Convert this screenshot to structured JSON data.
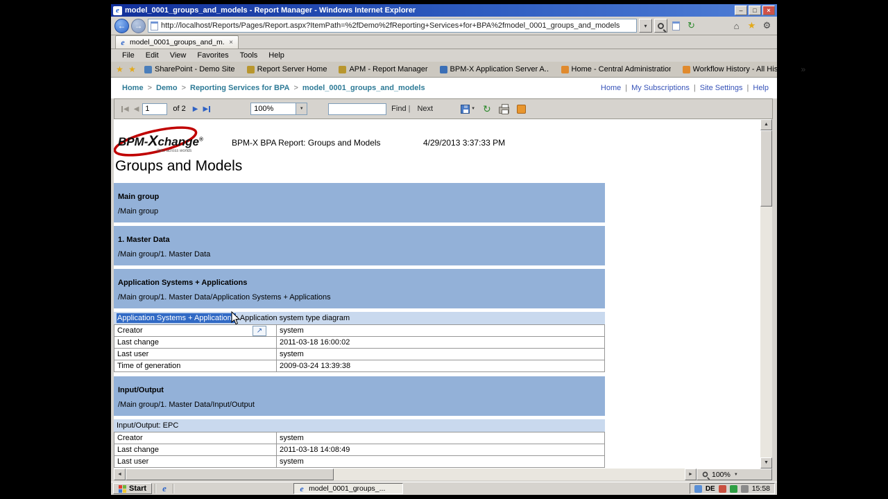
{
  "chrome": {
    "window_title": "model_0001_groups_and_models - Report Manager - Windows Internet Explorer",
    "url": "http://localhost/Reports/Pages/Report.aspx?ItemPath=%2fDemo%2fReporting+Services+for+BPA%2fmodel_0001_groups_and_models",
    "tab_label": "model_0001_groups_and_m...",
    "menu": [
      "File",
      "Edit",
      "View",
      "Favorites",
      "Tools",
      "Help"
    ],
    "favorites": [
      {
        "label": "SharePoint - Demo Site",
        "color": "#4a7ebb"
      },
      {
        "label": "Report Server Home",
        "color": "#b8962e"
      },
      {
        "label": "APM - Report Manager",
        "color": "#b8962e"
      },
      {
        "label": "BPM-X Application Server A...",
        "color": "#3b6fb6"
      },
      {
        "label": "Home - Central Administration",
        "color": "#e08a2e"
      },
      {
        "label": "Workflow History - All History",
        "color": "#e08a2e"
      }
    ]
  },
  "breadcrumb": {
    "sep": ">",
    "items": [
      "Home",
      "Demo",
      "Reporting Services for BPA",
      "model_0001_groups_and_models"
    ]
  },
  "top_links": {
    "sep": "|",
    "items": [
      "Home",
      "My Subscriptions",
      "Site Settings",
      "Help"
    ]
  },
  "viewer": {
    "page_value": "1",
    "of_label": "of 2",
    "zoom_value": "100%",
    "find_label": "Find",
    "sep": "|",
    "next_label": "Next"
  },
  "report": {
    "brand": {
      "prefix": "BPM-",
      "x": "X",
      "suffix": "change",
      "reg": "®",
      "tagline": "links across worlds"
    },
    "header_title": "BPM-X BPA Report: Groups and Models",
    "header_datetime": "4/29/2013 3:37:33 PM",
    "page_title": "Groups and Models",
    "groups": [
      {
        "name": "Main group",
        "path": "/Main group"
      },
      {
        "name": "1. Master Data",
        "path": "/Main group/1. Master Data"
      },
      {
        "name": "Application Systems + Applications",
        "path": "/Main group/1. Master Data/Application Systems + Applications",
        "model": {
          "name": "Application Systems + Applications",
          "type_suffix": ": Application system type diagram",
          "rows": [
            {
              "label": "Creator",
              "value": "system"
            },
            {
              "label": "Last change",
              "value": "2011-03-18 16:00:02"
            },
            {
              "label": "Last user",
              "value": "system"
            },
            {
              "label": "Time of generation",
              "value": "2009-03-24 13:39:38"
            }
          ]
        }
      },
      {
        "name": "Input/Output",
        "path": "/Main group/1. Master Data/Input/Output",
        "model": {
          "name": "Input/Output",
          "type_suffix": ": EPC",
          "rows": [
            {
              "label": "Creator",
              "value": "system"
            },
            {
              "label": "Last change",
              "value": "2011-03-18 14:08:49"
            },
            {
              "label": "Last user",
              "value": "system"
            }
          ]
        }
      }
    ]
  },
  "page_zoom": {
    "value": "100%"
  },
  "taskbar": {
    "start_label": "Start",
    "task_label": "model_0001_groups_...",
    "lang": "DE",
    "time": "15:58",
    "tray_colors": [
      "#5a8fd6",
      "#c94f3f",
      "#2f9e44",
      "#8a8a8a"
    ]
  },
  "icons": {
    "ie": "e",
    "back": "←",
    "forward": "→",
    "dropdown": "▾",
    "caret_down": "▼",
    "refresh": "↻",
    "home": "⌂",
    "star": "★",
    "gear": "⚙",
    "close": "×",
    "minimize": "–",
    "maximize": "□",
    "up": "▲",
    "down": "▼",
    "left": "◄",
    "right": "►",
    "first": "◀",
    "prev": "◀",
    "next": "▶",
    "last": "▶",
    "sort": "↗",
    "overflow": "»"
  }
}
